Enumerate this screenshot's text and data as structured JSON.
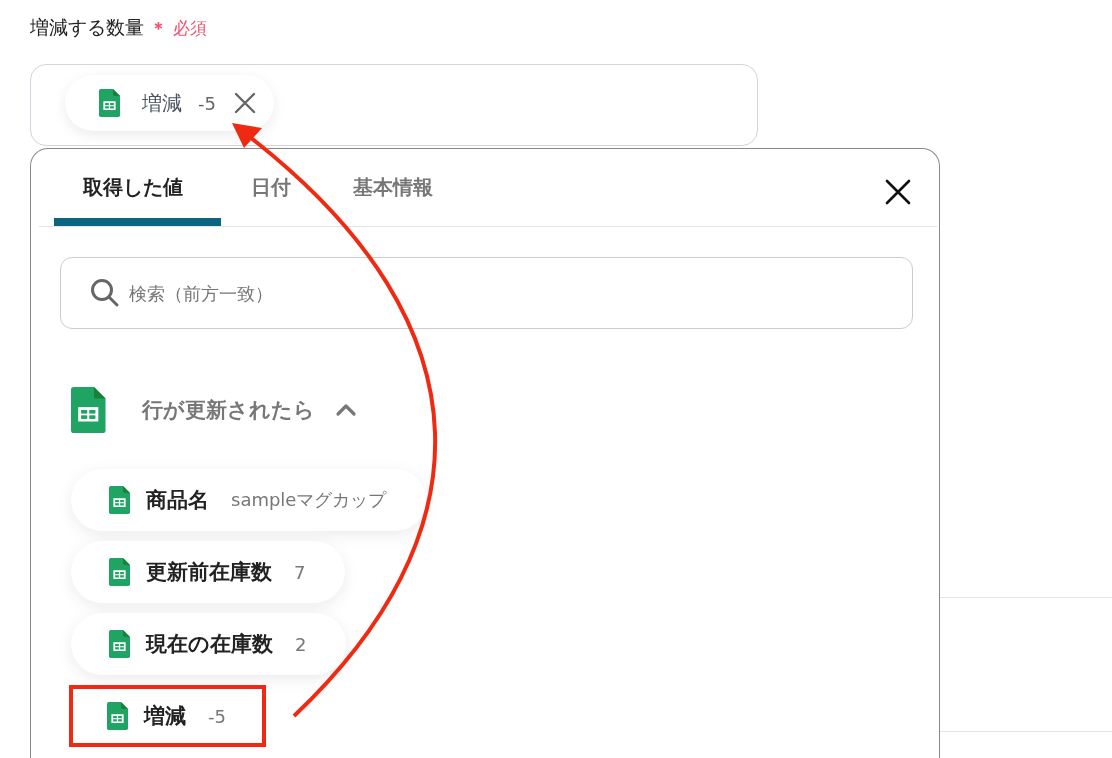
{
  "field": {
    "label": "増減する数量",
    "required_mark": "＊",
    "required_text": "必須",
    "chips": [
      {
        "name": "増減",
        "value": "-5"
      }
    ]
  },
  "panel": {
    "tabs": [
      {
        "label": "取得した値",
        "selected": true
      },
      {
        "label": "日付",
        "selected": false
      },
      {
        "label": "基本情報",
        "selected": false
      }
    ],
    "search": {
      "placeholder": "検索（前方一致）"
    },
    "group": {
      "title": "行が更新されたら",
      "expanded": true,
      "items": [
        {
          "name": "商品名",
          "value": "sampleマグカップ",
          "highlighted": false
        },
        {
          "name": "更新前在庫数",
          "value": "7",
          "highlighted": false
        },
        {
          "name": "現在の在庫数",
          "value": "2",
          "highlighted": false
        },
        {
          "name": "増減",
          "value": "-5",
          "highlighted": true
        }
      ]
    }
  }
}
